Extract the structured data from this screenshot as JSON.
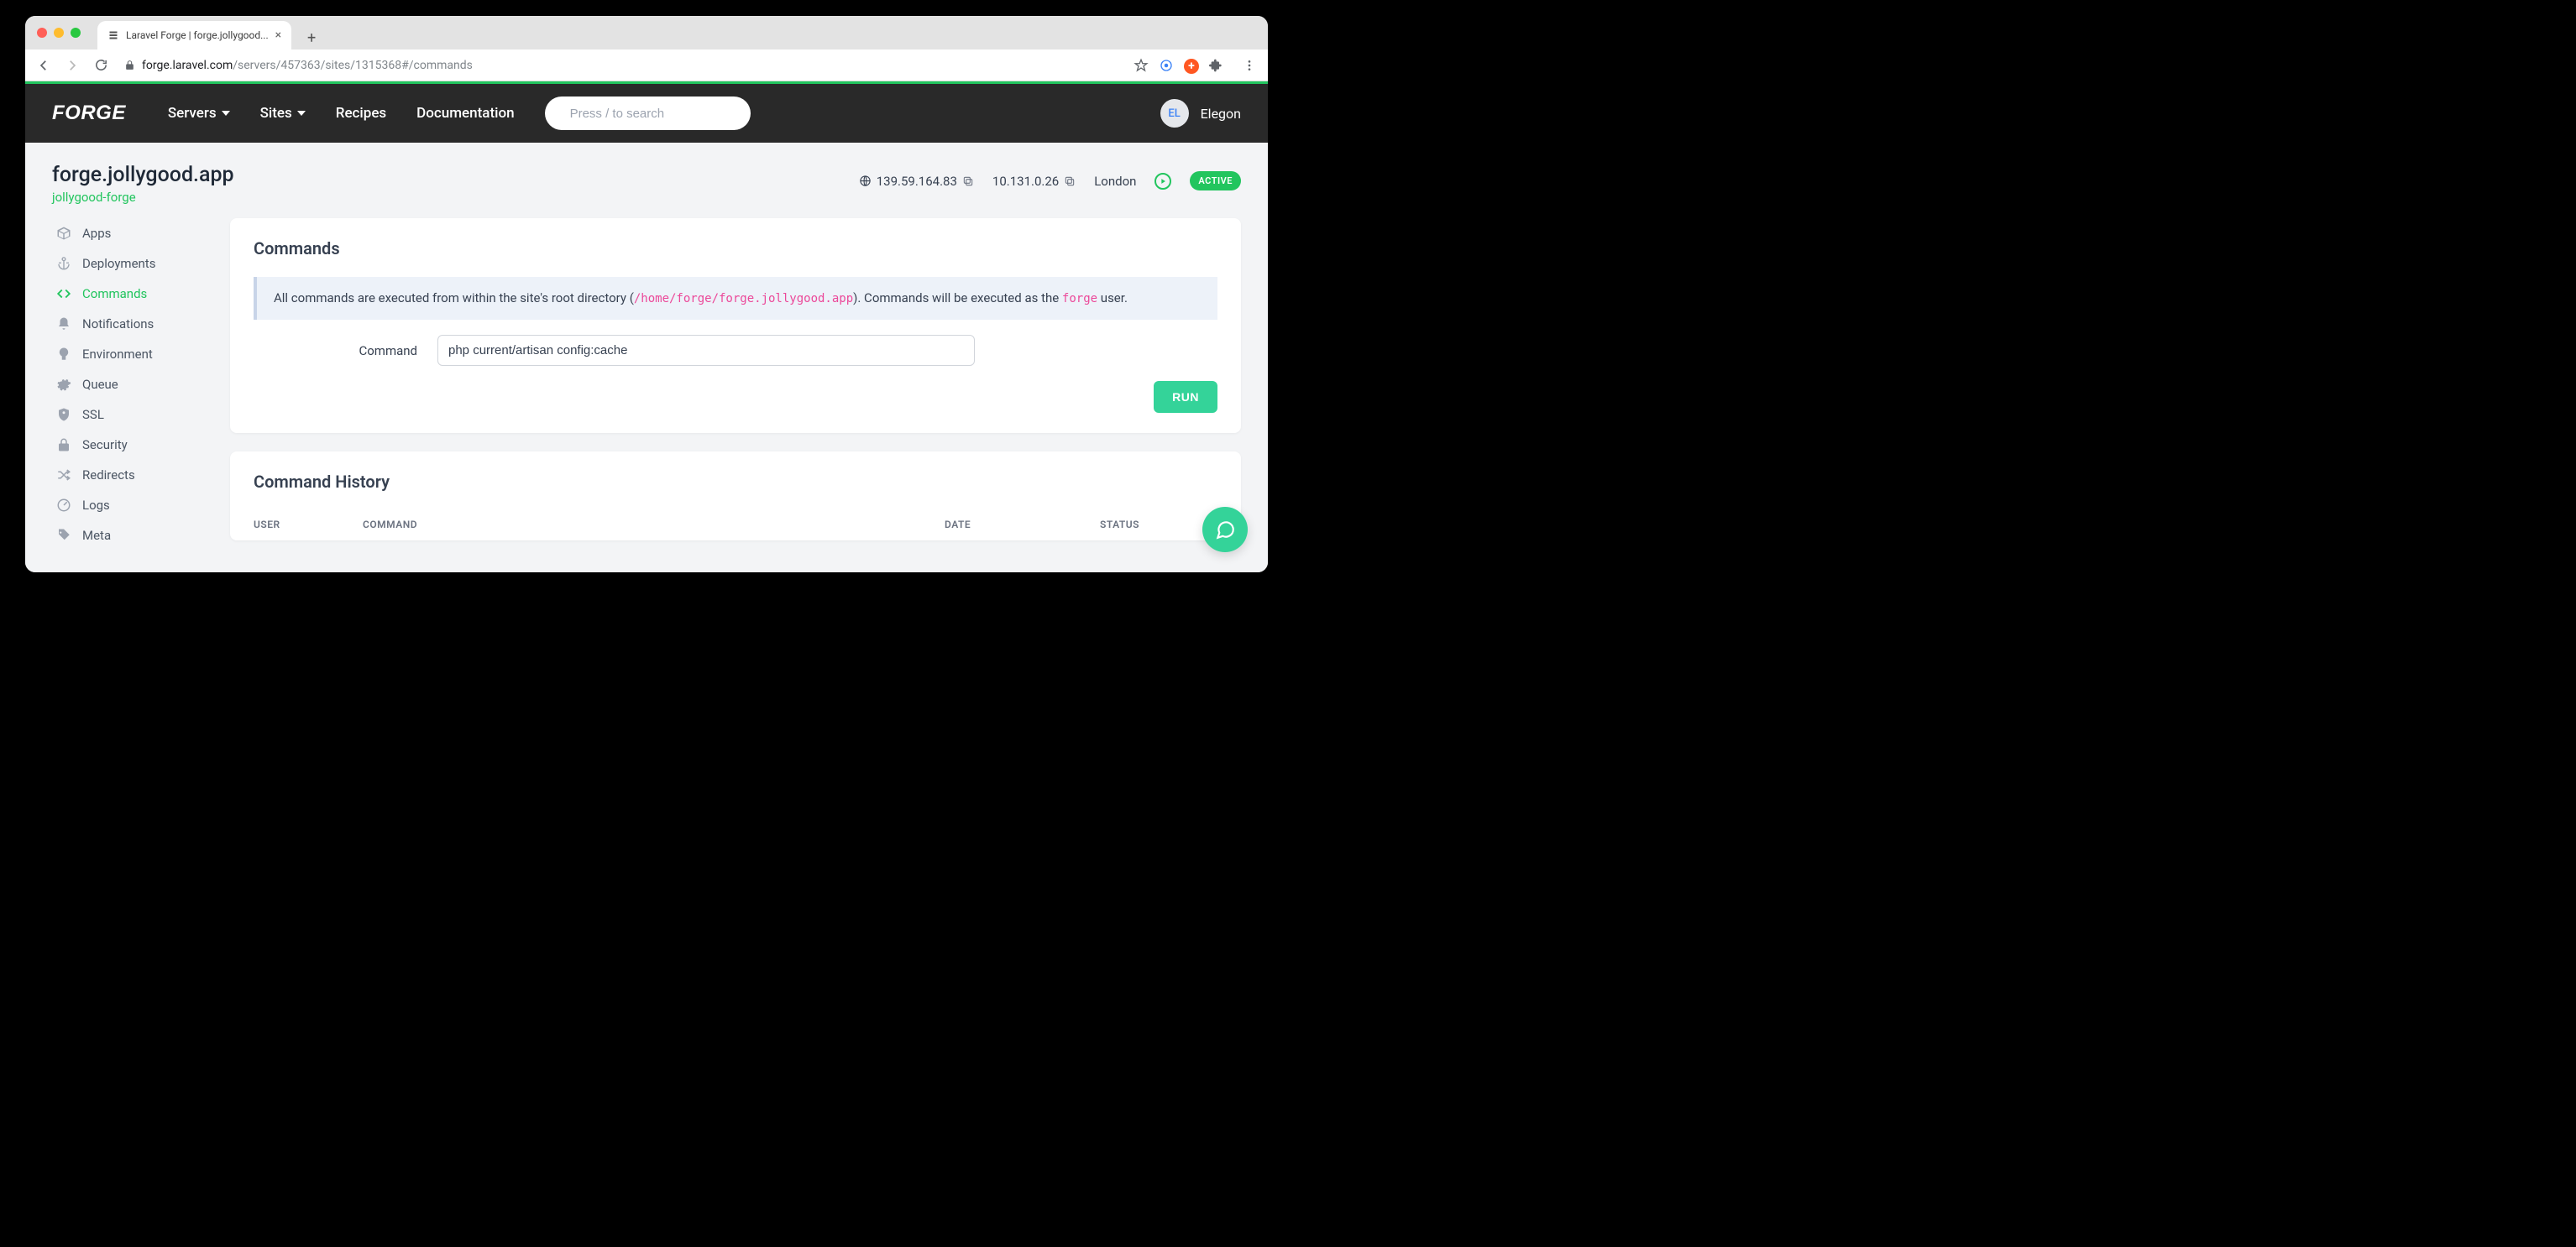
{
  "browser": {
    "tab_title": "Laravel Forge | forge.jollygood...",
    "url_host": "forge.laravel.com",
    "url_path": "/servers/457363/sites/1315368#/commands"
  },
  "header": {
    "logo": "FORGE",
    "nav": {
      "servers": "Servers",
      "sites": "Sites",
      "recipes": "Recipes",
      "docs": "Documentation"
    },
    "search_placeholder": "Press / to search",
    "avatar_initials": "EL",
    "username": "Elegon"
  },
  "page": {
    "title": "forge.jollygood.app",
    "server_link": "jollygood-forge",
    "public_ip": "139.59.164.83",
    "private_ip": "10.131.0.26",
    "region": "London",
    "status_badge": "ACTIVE"
  },
  "sidebar": {
    "apps": "Apps",
    "deployments": "Deployments",
    "commands": "Commands",
    "notifications": "Notifications",
    "environment": "Environment",
    "queue": "Queue",
    "ssl": "SSL",
    "security": "Security",
    "redirects": "Redirects",
    "logs": "Logs",
    "meta": "Meta"
  },
  "commands_card": {
    "title": "Commands",
    "info_prefix": "All commands are executed from within the site's root directory (",
    "info_path": "/home/forge/forge.jollygood.app",
    "info_mid": "). Commands will be executed as the ",
    "info_user": "forge",
    "info_suffix": " user.",
    "field_label": "Command",
    "field_value": "php current/artisan config:cache",
    "run_label": "RUN"
  },
  "history_card": {
    "title": "Command History",
    "cols": {
      "user": "USER",
      "command": "COMMAND",
      "date": "DATE",
      "status": "STATUS"
    }
  }
}
